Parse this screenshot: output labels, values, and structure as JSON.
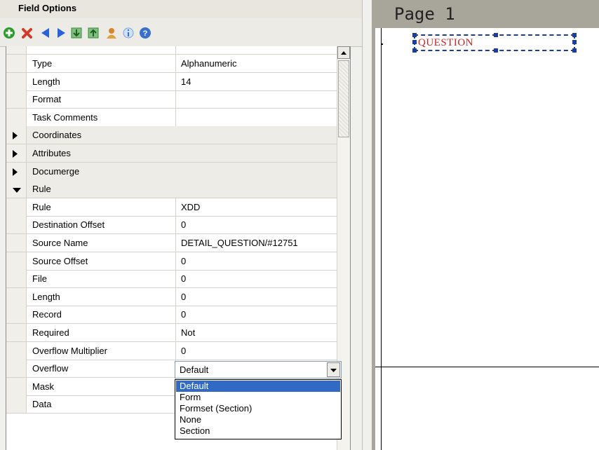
{
  "panel": {
    "title": "Field Options"
  },
  "toolbar": {
    "buttons": [
      {
        "icon": "add-icon",
        "color": "#2a9d2a"
      },
      {
        "icon": "delete-icon",
        "color": "#d23a2a"
      },
      {
        "icon": "arrow-left-icon",
        "color": "#2b62d9"
      },
      {
        "icon": "arrow-right-icon",
        "color": "#2b62d9"
      },
      {
        "icon": "import-icon",
        "color": "#3a8a3a"
      },
      {
        "icon": "export-icon",
        "color": "#3a8a3a"
      },
      {
        "icon": "person-icon",
        "color": "#d8862a"
      },
      {
        "icon": "info-icon",
        "color": "#7aa0e0"
      },
      {
        "icon": "help-icon",
        "color": "#3a6fd0"
      }
    ]
  },
  "grid": {
    "rows": [
      {
        "kind": "prop",
        "name": "Type",
        "value": "Alphanumeric"
      },
      {
        "kind": "prop",
        "name": "Length",
        "value": "14"
      },
      {
        "kind": "prop",
        "name": "Format",
        "value": ""
      },
      {
        "kind": "prop",
        "name": "Task Comments",
        "value": ""
      },
      {
        "kind": "cat",
        "name": "Coordinates",
        "expanded": false
      },
      {
        "kind": "cat",
        "name": "Attributes",
        "expanded": false
      },
      {
        "kind": "cat",
        "name": "Documerge",
        "expanded": false
      },
      {
        "kind": "cat",
        "name": "Rule",
        "expanded": true
      },
      {
        "kind": "prop",
        "name": "Rule",
        "value": "XDD"
      },
      {
        "kind": "prop",
        "name": "Destination Offset",
        "value": "0"
      },
      {
        "kind": "prop",
        "name": "Source Name",
        "value": "DETAIL_QUESTION/#12751"
      },
      {
        "kind": "prop",
        "name": "Source Offset",
        "value": "0"
      },
      {
        "kind": "prop",
        "name": "File",
        "value": "0"
      },
      {
        "kind": "prop",
        "name": "Length",
        "value": "0"
      },
      {
        "kind": "prop",
        "name": "Record",
        "value": "0"
      },
      {
        "kind": "prop",
        "name": "Required",
        "value": "Not"
      },
      {
        "kind": "prop",
        "name": "Overflow Multiplier",
        "value": "0"
      },
      {
        "kind": "combo",
        "name": "Overflow",
        "value": "Default"
      },
      {
        "kind": "prop",
        "name": "Mask",
        "value": ""
      },
      {
        "kind": "prop",
        "name": "Data",
        "value": ""
      }
    ]
  },
  "dropdown": {
    "options": [
      "Default",
      "Form",
      "Formset (Section)",
      "None",
      "Section"
    ],
    "selected": "Default"
  },
  "canvas": {
    "page_label": "Page 1",
    "field_text": "QUESTION",
    "field_text_color": "#d02020",
    "selection_color": "#1c3d9c"
  }
}
